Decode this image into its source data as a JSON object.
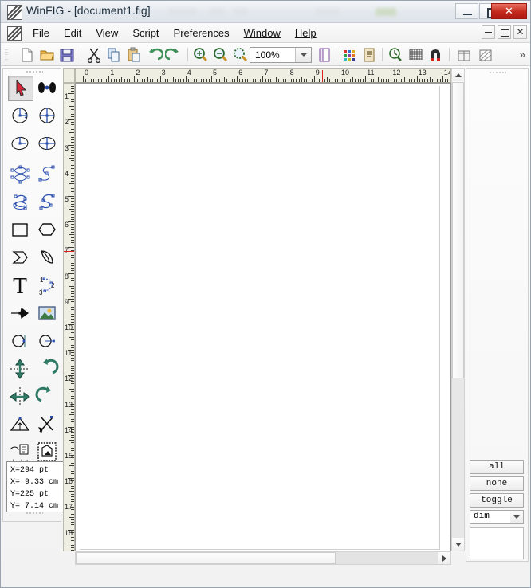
{
  "window": {
    "title": "WinFIG - [document1.fig]",
    "app_icon": "winfig-icon",
    "minimize_label": "",
    "maximize_label": "",
    "close_label": "✕"
  },
  "menu": {
    "items": [
      {
        "label": "File",
        "accel": ""
      },
      {
        "label": "Edit",
        "accel": ""
      },
      {
        "label": "View",
        "accel": ""
      },
      {
        "label": "Script",
        "accel": ""
      },
      {
        "label": "Preferences",
        "accel": ""
      },
      {
        "label": "Window",
        "accel": "W"
      },
      {
        "label": "Help",
        "accel": "H"
      }
    ],
    "doc_buttons": [
      "restore-document",
      "maximize-document",
      "close-document"
    ]
  },
  "toolbar": {
    "zoom_value": "100%",
    "overflow_label": "»",
    "buttons": [
      {
        "name": "new-file-icon"
      },
      {
        "name": "open-file-icon"
      },
      {
        "name": "save-file-icon"
      },
      {
        "name": "cut-icon"
      },
      {
        "name": "copy-icon"
      },
      {
        "name": "paste-icon"
      },
      {
        "name": "undo-icon"
      },
      {
        "name": "redo-icon"
      },
      {
        "name": "zoom-in-icon"
      },
      {
        "name": "zoom-out-icon"
      },
      {
        "name": "zoom-fit-icon"
      },
      {
        "name": "page-setup-icon"
      },
      {
        "name": "color-palette-icon"
      },
      {
        "name": "text-properties-icon"
      },
      {
        "name": "zoom-select-icon"
      },
      {
        "name": "grid-icon"
      },
      {
        "name": "snap-magnet-icon"
      },
      {
        "name": "export-icon"
      },
      {
        "name": "hatch-icon"
      }
    ]
  },
  "palette": {
    "tools": [
      {
        "name": "select-arrow-tool",
        "active": true
      },
      {
        "name": "point-edit-tool",
        "active": false
      },
      {
        "name": "circle-radius-tool",
        "active": false
      },
      {
        "name": "circle-diameter-tool",
        "active": false
      },
      {
        "name": "ellipse-radius-tool",
        "active": false
      },
      {
        "name": "ellipse-diameter-tool",
        "active": false
      },
      {
        "name": "closed-spline-tool",
        "active": false
      },
      {
        "name": "open-spline-tool",
        "active": false
      },
      {
        "name": "closed-interpolated-spline-tool",
        "active": false
      },
      {
        "name": "open-interpolated-spline-tool",
        "active": false
      },
      {
        "name": "rectangle-tool",
        "active": false
      },
      {
        "name": "polygon-tool",
        "active": false
      },
      {
        "name": "polyline-tool",
        "active": false
      },
      {
        "name": "arc-tool",
        "active": false
      },
      {
        "name": "text-tool",
        "active": false
      },
      {
        "name": "regular-polygon-tool",
        "active": false
      },
      {
        "name": "arrow-tool",
        "active": false
      },
      {
        "name": "picture-tool",
        "active": false
      },
      {
        "name": "align-object-tool",
        "active": false
      },
      {
        "name": "scale-object-tool",
        "active": false
      },
      {
        "name": "flip-vertical-tool",
        "active": false
      },
      {
        "name": "rotate-ccw-tool",
        "active": false
      },
      {
        "name": "flip-horizontal-tool",
        "active": false
      },
      {
        "name": "rotate-cw-tool",
        "active": false
      },
      {
        "name": "align-tool",
        "active": false
      },
      {
        "name": "cut-object-tool",
        "active": false
      },
      {
        "name": "update-tool",
        "active": false
      },
      {
        "name": "edit-properties-tool",
        "active": false
      },
      {
        "name": "delete-tool",
        "active": false
      }
    ],
    "update_label": "Update"
  },
  "status": {
    "coords_lines": [
      "X=294 pt",
      "X= 9.33 cm",
      "Y=225 pt",
      "Y= 7.14 cm"
    ],
    "x_pt": "294",
    "x_cm": "9.33",
    "y_pt": "225",
    "y_cm": "7.14"
  },
  "rulers": {
    "unit": "cm",
    "h_labels": [
      "0",
      "1",
      "2",
      "3",
      "4",
      "5",
      "6",
      "7",
      "8",
      "9",
      "10",
      "11",
      "12",
      "13",
      "14"
    ],
    "v_labels": [
      "1",
      "2",
      "3",
      "4",
      "5",
      "6",
      "7",
      "8",
      "9",
      "10",
      "11",
      "12",
      "13",
      "14",
      "15",
      "16",
      "17",
      "18"
    ],
    "h_marker_cm": 9.33,
    "v_marker_cm": 7.14,
    "marker_color": "#e02020"
  },
  "right_panel": {
    "buttons": [
      {
        "label": "all",
        "name": "select-all-button"
      },
      {
        "label": "none",
        "name": "select-none-button"
      },
      {
        "label": "toggle",
        "name": "toggle-selection-button"
      }
    ],
    "combo_value": "dim",
    "combo_options": [
      "dim"
    ]
  }
}
